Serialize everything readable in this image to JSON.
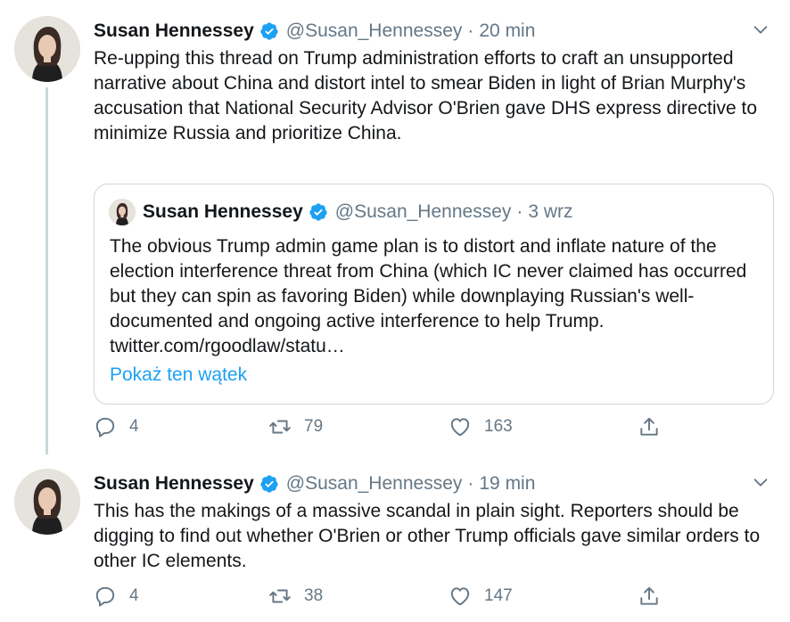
{
  "tweets": [
    {
      "author_name": "Susan Hennessey",
      "handle": "@Susan_Hennessey",
      "separator": "·",
      "time": "20 min",
      "text": "Re-upping this thread on Trump administration efforts to craft an unsupported narrative about China and distort intel to smear Biden in light of Brian Murphy's accusation that National Security Advisor O'Brien gave DHS express directive to minimize Russia and prioritize China.",
      "quoted": {
        "author_name": "Susan Hennessey",
        "handle": "@Susan_Hennessey",
        "separator": "·",
        "time": "3 wrz",
        "text": "The obvious Trump admin game plan is to distort and inflate nature of the election interference threat from China (which IC never claimed has occurred but they can spin as favoring Biden) while downplaying Russian's well-documented and ongoing active interference to help Trump. twitter.com/rgoodlaw/statu…",
        "show_thread_label": "Pokaż ten wątek"
      },
      "reply_count": "4",
      "retweet_count": "79",
      "like_count": "163"
    },
    {
      "author_name": "Susan Hennessey",
      "handle": "@Susan_Hennessey",
      "separator": "·",
      "time": "19 min",
      "text": "This has the makings of a massive scandal in plain sight. Reporters should be digging to find out whether O'Brien or other Trump officials gave similar orders to other IC elements.",
      "reply_count": "4",
      "retweet_count": "38",
      "like_count": "147"
    }
  ],
  "icons": {
    "verified": "verified-badge-icon",
    "caret": "chevron-down-icon",
    "reply": "reply-icon",
    "retweet": "retweet-icon",
    "like": "heart-icon",
    "share": "share-icon"
  },
  "colors": {
    "accent": "#1da1f2",
    "secondary_text": "#657786",
    "border": "#ccd6dd",
    "text": "#14171a"
  }
}
